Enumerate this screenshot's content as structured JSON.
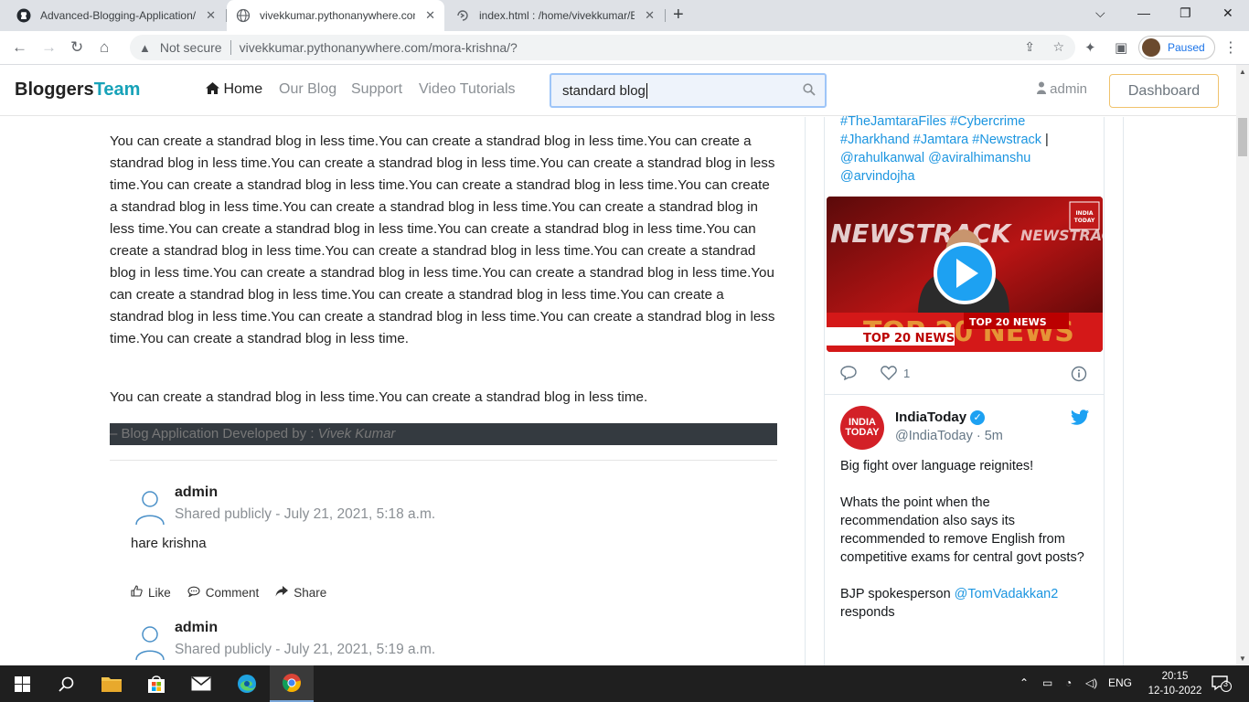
{
  "browser": {
    "tabs": [
      {
        "title": "Advanced-Blogging-Application/",
        "icon": "github-icon"
      },
      {
        "title": "vivekkumar.pythonanywhere.com",
        "icon": "globe-icon"
      },
      {
        "title": "index.html : /home/vivekkumar/E",
        "icon": "pythonanywhere-icon"
      }
    ],
    "not_secure_label": "Not secure",
    "url": "vivekkumar.pythonanywhere.com/mora-krishna/?",
    "profile_label": "Paused"
  },
  "site": {
    "brand_part1": "Bloggers",
    "brand_part2": "Team",
    "nav": {
      "home": "Home",
      "our_blog": "Our Blog",
      "support": "Support",
      "video_tutorials": "Video Tutorials"
    },
    "search_value": "standard blog",
    "user_label": "admin",
    "dashboard_label": "Dashboard"
  },
  "post": {
    "paragraph1": "You can create a standrad blog in less time.You can create a standrad blog in less time.You can create a standrad blog in less time.You can create a standrad blog in less time.You can create a standrad blog in less time.You can create a standrad blog in less time.You can create a standrad blog in less time.You can create a standrad blog in less time.You can create a standrad blog in less time.You can create a standrad blog in less time.You can create a standrad blog in less time.You can create a standrad blog in less time.You can create a standrad blog in less time.You can create a standrad blog in less time.You can create a standrad blog in less time.You can create a standrad blog in less time.You can create a standrad blog in less time.You can create a standrad blog in less time.You can create a standrad blog in less time.You can create a standrad blog in less time.You can create a standrad blog in less time.You can create a standrad blog in less time.You can create a standrad blog in less time.",
    "paragraph2": "You can create a standrad blog in less time.You can create a standrad blog in less time.",
    "credit_prefix": "– Blog Application Developed by : ",
    "credit_name": "Vivek Kumar"
  },
  "comments": [
    {
      "author": "admin",
      "meta": "Shared publicly - July 21, 2021, 5:18 a.m.",
      "text": "hare krishna"
    },
    {
      "author": "admin",
      "meta": "Shared publicly - July 21, 2021, 5:19 a.m.",
      "text": ""
    }
  ],
  "comment_actions": {
    "like": "Like",
    "comment": "Comment",
    "share": "Share"
  },
  "twitter": {
    "tags_line1": "#TheJamtaraFiles #Cybercrime",
    "tags_line2a": "#Jharkhand #Jamtara #Newstrack",
    "tags_line2_sep": " |",
    "tags_line3": "@rahulkanwal @aviralhimanshu",
    "tags_line4": "@arvindojha",
    "video_text_top": "NEWSTRACK",
    "video_text_banner": "TOP 20 NEWS",
    "video_text_big": "TOP 20 NEWS",
    "like_count": "1",
    "account_name": "IndiaToday",
    "account_handle": "@IndiaToday · 5m",
    "logo_text_1": "INDIA",
    "logo_text_2": "TODAY",
    "body_p1": "Big fight over language reignites!",
    "body_p2": "Whats the point when the recommendation also says its recommended to remove English from competitive exams for central govt posts?",
    "body_p3a": "BJP spokesperson ",
    "body_p3_link": "@TomVadakkan2",
    "body_p3b": " responds"
  },
  "taskbar": {
    "language": "ENG",
    "time": "20:15",
    "date": "12-10-2022",
    "notifications": "3"
  },
  "colors": {
    "brand_accent": "#17a2b8",
    "twitter_blue": "#1da1f2",
    "dashboard_border": "#f0c36d",
    "credit_bg": "#343a40"
  }
}
